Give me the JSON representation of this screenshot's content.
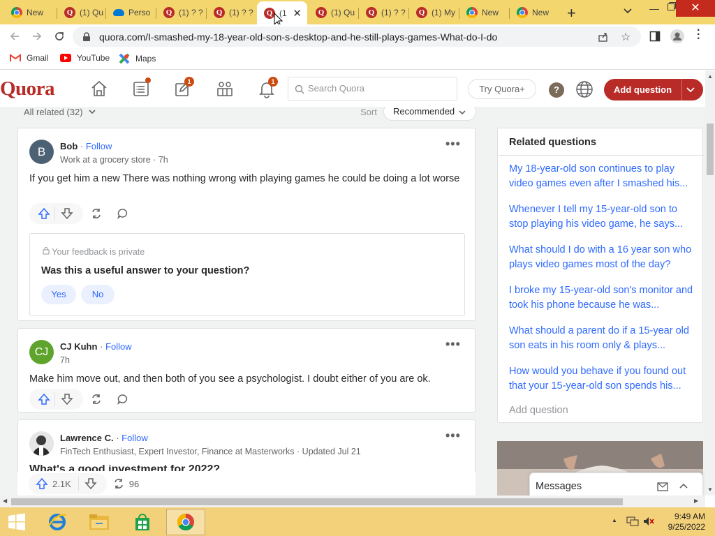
{
  "browser": {
    "tabs": [
      {
        "label": "New",
        "icon": "chrome-icon"
      },
      {
        "label": "(1) Qu",
        "icon": "quora-icon"
      },
      {
        "label": "Perso",
        "icon": "cloud-icon"
      },
      {
        "label": "(1) ? ?",
        "icon": "quora-icon"
      },
      {
        "label": "(1) ? ?",
        "icon": "quora-icon"
      },
      {
        "label": "(1",
        "icon": "quora-icon",
        "active": true
      },
      {
        "label": "(1) Qu",
        "icon": "quora-icon"
      },
      {
        "label": "(1) ? ?",
        "icon": "quora-icon"
      },
      {
        "label": "(1) My",
        "icon": "quora-icon"
      },
      {
        "label": "New",
        "icon": "chrome-icon"
      },
      {
        "label": "New",
        "icon": "chrome-icon"
      }
    ],
    "url": "quora.com/I-smashed-my-18-year-old-son-s-desktop-and-he-still-plays-games-What-do-I-do",
    "bookmarks": [
      {
        "label": "Gmail",
        "icon": "gmail-icon"
      },
      {
        "label": "YouTube",
        "icon": "youtube-icon"
      },
      {
        "label": "Maps",
        "icon": "maps-icon"
      }
    ]
  },
  "header": {
    "logo": "Quora",
    "following_badge": "1",
    "notifications_badge": "1",
    "search_placeholder": "Search Quora",
    "try_plus": "Try Quora+",
    "help": "?",
    "add_question": "Add question"
  },
  "filters": {
    "all_related": "All related (32)",
    "sort_label": "Sort",
    "sort_value": "Recommended"
  },
  "answers": [
    {
      "author": "Bob",
      "avatar_letter": "B",
      "avatar_color": "#4d6174",
      "follow": "Follow",
      "credential": "Work at a grocery store · 7h",
      "text": "If you get him a new There was nothing wrong with playing games he could be doing a lot worse",
      "feedback": {
        "private_note": "Your feedback is private",
        "question": "Was this a useful answer to your question?",
        "yes": "Yes",
        "no": "No"
      }
    },
    {
      "author": "CJ Kuhn",
      "avatar_letter": "CJ",
      "avatar_color": "#5ea32b",
      "follow": "Follow",
      "credential": "7h",
      "text": "Make him move out, and then both of you see a psychologist. I doubt either of you are ok."
    },
    {
      "author": "Lawrence C.",
      "follow": "Follow",
      "credential": "FinTech Enthusiast, Expert Investor, Finance at Masterworks · Updated Jul 21",
      "promoted_title": "What's a good investment for 2022?",
      "upvotes": "2.1K",
      "shares": "96"
    }
  ],
  "sidebar": {
    "title": "Related questions",
    "questions": [
      "My 18-year-old son continues to play video games even after I smashed his...",
      "Whenever I tell my 15-year-old son to stop playing his video game, he says...",
      "What should I do with a 16 year son who plays video games most of the day?",
      "I broke my 15-year-old son's monitor and took his phone because he was...",
      "What should a parent do if a 15-year old son eats in his room only & plays...",
      "How would you behave if you found out that your 15-year-old son spends his..."
    ],
    "add_question": "Add question"
  },
  "messages": {
    "label": "Messages"
  },
  "taskbar": {
    "time": "9:49 AM",
    "date": "9/25/2022"
  },
  "colors": {
    "brand": "#b92b27",
    "link": "#2e69ff",
    "tabstrip": "#f4d66e",
    "taskbar": "#f3d07a"
  }
}
